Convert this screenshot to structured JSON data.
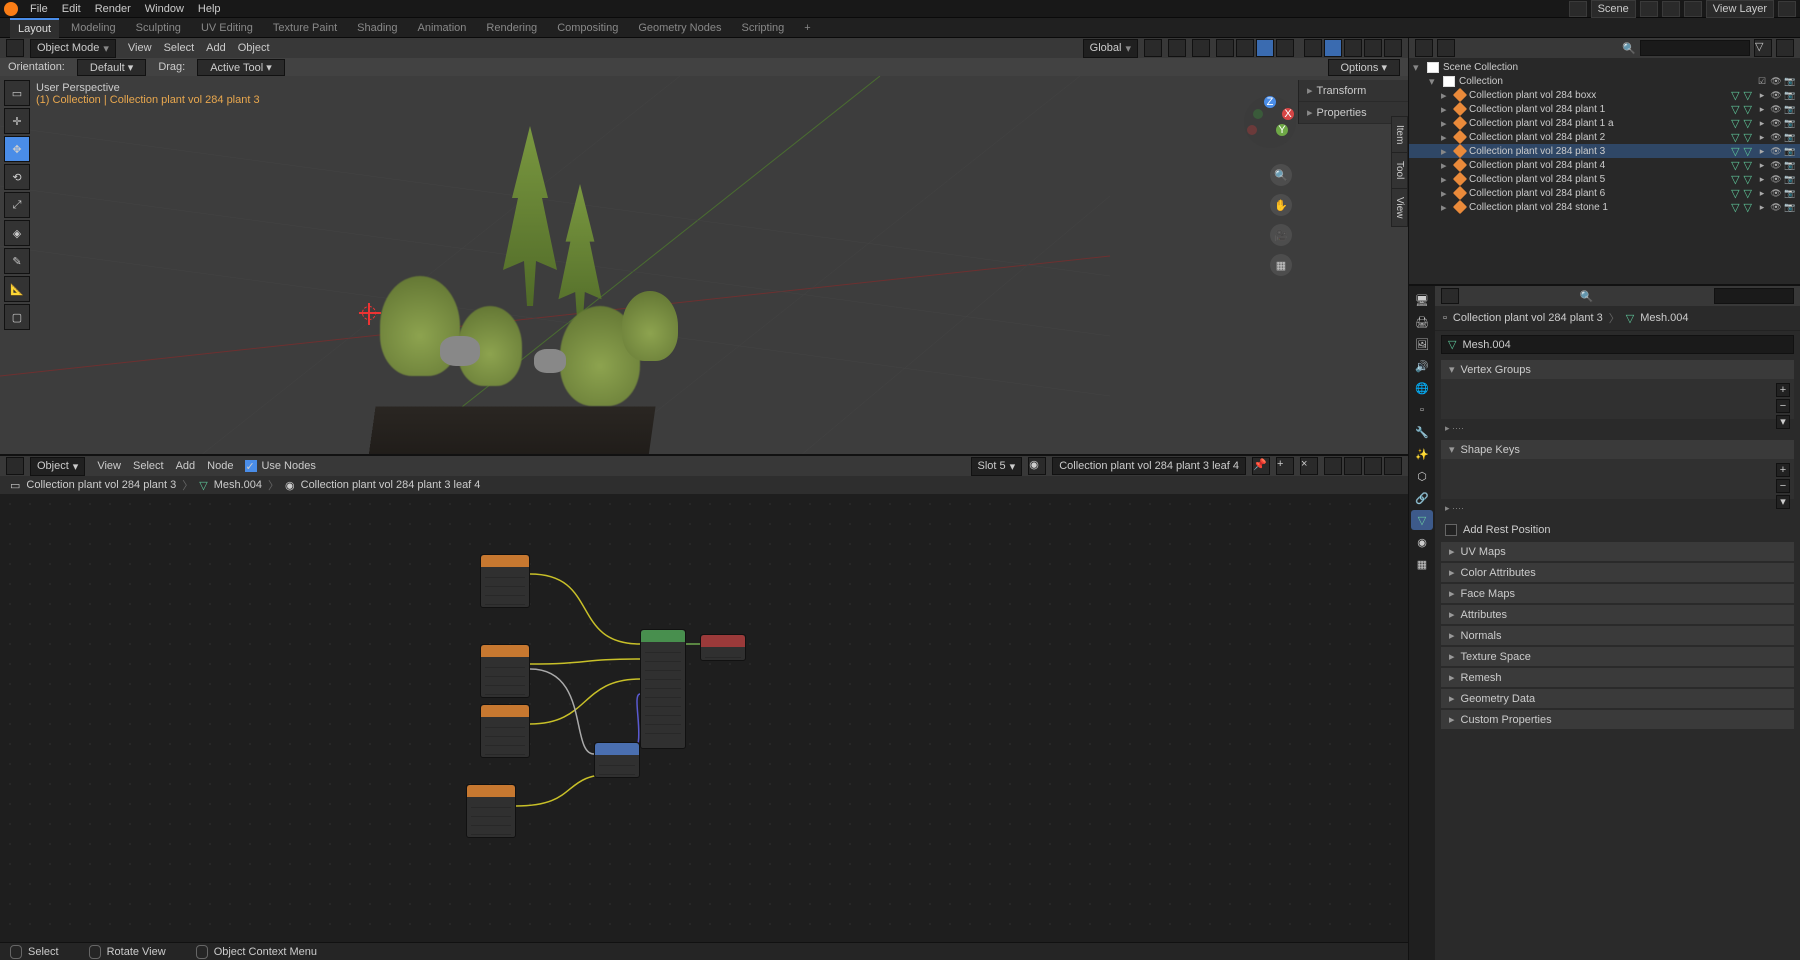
{
  "top_menu": [
    "File",
    "Edit",
    "Render",
    "Window",
    "Help"
  ],
  "workspaces": [
    "Layout",
    "Modeling",
    "Sculpting",
    "UV Editing",
    "Texture Paint",
    "Shading",
    "Animation",
    "Rendering",
    "Compositing",
    "Geometry Nodes",
    "Scripting"
  ],
  "workspace_active": "Layout",
  "scene_field": "Scene",
  "viewlayer_field": "View Layer",
  "viewport": {
    "mode": "Object Mode",
    "menus": [
      "View",
      "Select",
      "Add",
      "Object"
    ],
    "orientation_label": "Orientation:",
    "orientation": "Default",
    "drag_label": "Drag:",
    "drag": "Active Tool",
    "global": "Global",
    "overlay_l1": "User Perspective",
    "overlay_l2": "(1) Collection | Collection plant vol 284 plant 3",
    "options_btn": "Options",
    "npanel": [
      "Transform",
      "Properties"
    ],
    "vtabs": [
      "Item",
      "Tool",
      "View"
    ]
  },
  "node_editor": {
    "editor_type": "Object",
    "menus": [
      "View",
      "Select",
      "Add",
      "Node"
    ],
    "use_nodes_label": "Use Nodes",
    "slot": "Slot 5",
    "material": "Collection plant vol 284 plant 3 leaf 4",
    "crumb": [
      "Collection plant vol 284 plant 3",
      "Mesh.004",
      "Collection plant vol 284 plant 3 leaf 4"
    ]
  },
  "outliner": {
    "root": "Scene Collection",
    "collection": "Collection",
    "items": [
      "Collection plant vol 284 boxx",
      "Collection plant vol 284 plant 1",
      "Collection plant vol 284 plant 1 a",
      "Collection plant vol 284 plant 2",
      "Collection plant vol 284 plant 3",
      "Collection plant vol 284 plant 4",
      "Collection plant vol 284 plant 5",
      "Collection plant vol 284 plant 6",
      "Collection plant vol 284 stone 1"
    ],
    "selected_index": 4
  },
  "properties": {
    "crumb_obj": "Collection plant vol 284 plant 3",
    "crumb_mesh": "Mesh.004",
    "mesh_name": "Mesh.004",
    "panels_open": [
      {
        "title": "Vertex Groups"
      },
      {
        "title": "Shape Keys"
      }
    ],
    "add_rest": "Add Rest Position",
    "panels_closed": [
      "UV Maps",
      "Color Attributes",
      "Face Maps",
      "Attributes",
      "Normals",
      "Texture Space",
      "Remesh",
      "Geometry Data",
      "Custom Properties"
    ]
  },
  "statusbar": {
    "select": "Select",
    "rotate": "Rotate View",
    "context": "Object Context Menu"
  }
}
